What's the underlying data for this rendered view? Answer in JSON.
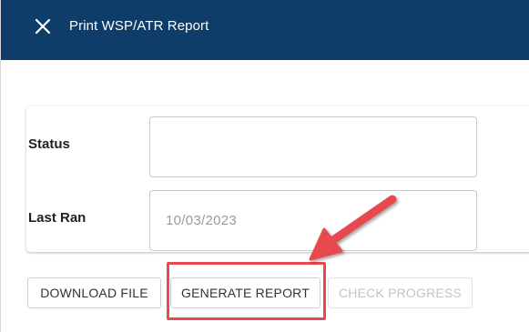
{
  "titlebar": {
    "title": "Print WSP/ATR Report",
    "close_icon": "close-icon",
    "background_color": "#0e3d6a"
  },
  "form": {
    "status": {
      "label": "Status",
      "value": ""
    },
    "last_ran": {
      "label": "Last Ran",
      "value": "10/03/2023"
    }
  },
  "actions": {
    "download_label": "DOWNLOAD FILE",
    "generate_label": "GENERATE REPORT",
    "check_progress_label": "CHECK PROGRESS",
    "check_progress_disabled": true
  },
  "annotation": {
    "color": "#e8484f",
    "target": "generate-report-button"
  }
}
